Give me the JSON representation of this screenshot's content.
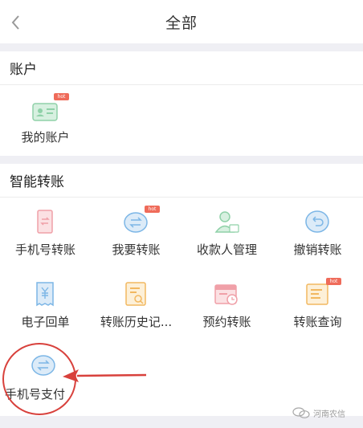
{
  "header": {
    "title": "全部"
  },
  "sections": {
    "account": {
      "title": "账户",
      "items": [
        {
          "label": "我的账户",
          "icon": "account-card-icon",
          "badge": "hot"
        }
      ]
    },
    "transfer": {
      "title": "智能转账",
      "items": [
        {
          "label": "手机号转账",
          "icon": "mobile-phone-icon",
          "badge": ""
        },
        {
          "label": "我要转账",
          "icon": "transfer-exchange-icon",
          "badge": "hot"
        },
        {
          "label": "收款人管理",
          "icon": "payee-person-icon",
          "badge": ""
        },
        {
          "label": "撤销转账",
          "icon": "undo-icon",
          "badge": ""
        },
        {
          "label": "电子回单",
          "icon": "receipt-yen-icon",
          "badge": ""
        },
        {
          "label": "转账历史记...",
          "icon": "history-search-icon",
          "badge": ""
        },
        {
          "label": "预约转账",
          "icon": "calendar-clock-icon",
          "badge": ""
        },
        {
          "label": "转账查询",
          "icon": "query-document-icon",
          "badge": "hot"
        },
        {
          "label": "手机号支付",
          "icon": "mobile-pay-exchange-icon",
          "badge": ""
        }
      ]
    }
  },
  "watermark": {
    "text": "河南农信"
  },
  "colors": {
    "accent_red": "#d8413c",
    "badge_red": "#ef6b5a",
    "icon_blue": "#7cb6e6",
    "icon_green": "#8fd1a8",
    "icon_orange": "#f2b860",
    "icon_pink": "#f0a0a8"
  }
}
